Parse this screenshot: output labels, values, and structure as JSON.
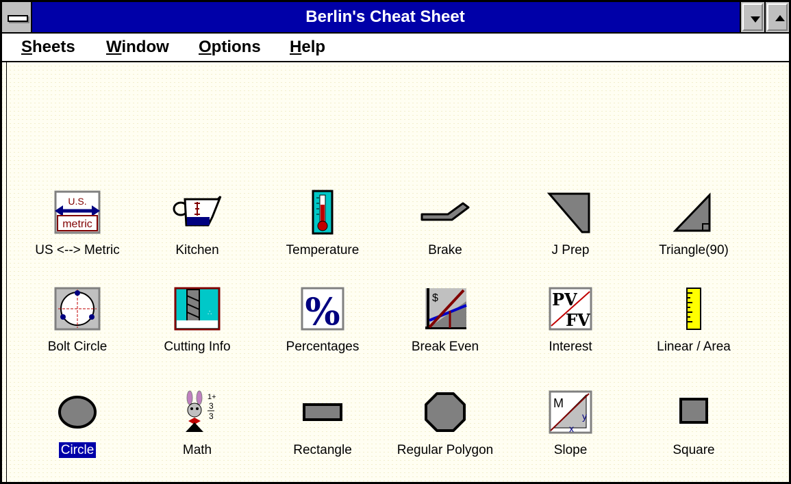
{
  "window": {
    "title": "Berlin's Cheat Sheet"
  },
  "menu": [
    {
      "accel": "S",
      "rest": "heets"
    },
    {
      "accel": "W",
      "rest": "indow"
    },
    {
      "accel": "O",
      "rest": "ptions"
    },
    {
      "accel": "H",
      "rest": "elp"
    }
  ],
  "icons": {
    "row1": [
      {
        "label": "US <--> Metric",
        "icon": "us-metric-icon"
      },
      {
        "label": "Kitchen",
        "icon": "measuring-cup-icon"
      },
      {
        "label": "Temperature",
        "icon": "thermometer-icon"
      },
      {
        "label": "Brake",
        "icon": "brake-icon"
      },
      {
        "label": "J Prep",
        "icon": "j-prep-icon"
      },
      {
        "label": "Triangle(90)",
        "icon": "right-triangle-icon"
      }
    ],
    "row2": [
      {
        "label": "Bolt Circle",
        "icon": "bolt-circle-icon"
      },
      {
        "label": "Cutting Info",
        "icon": "drill-bit-icon"
      },
      {
        "label": "Percentages",
        "icon": "percent-icon"
      },
      {
        "label": "Break Even",
        "icon": "break-even-chart-icon"
      },
      {
        "label": "Interest",
        "icon": "pv-fv-icon"
      },
      {
        "label": "Linear / Area",
        "icon": "ruler-icon"
      }
    ],
    "row3": [
      {
        "label": "Circle",
        "icon": "circle-icon",
        "selected": true
      },
      {
        "label": "Math",
        "icon": "math-rabbit-icon"
      },
      {
        "label": "Rectangle",
        "icon": "rectangle-icon"
      },
      {
        "label": "Regular Polygon",
        "icon": "octagon-icon"
      },
      {
        "label": "Slope",
        "icon": "slope-icon"
      },
      {
        "label": "Square",
        "icon": "square-icon"
      }
    ]
  },
  "icon_text": {
    "us": "U.S.",
    "metric": "metric",
    "dollar": "$",
    "pv": "PV",
    "fv": "FV",
    "m": "M",
    "x": "x",
    "y": "y",
    "frac_top": "1+",
    "frac_mid": "3",
    "frac_bot": "3"
  },
  "colors": {
    "titlebar": "#0000a8",
    "selection": "#0000a8",
    "shape_fill": "#808080"
  }
}
